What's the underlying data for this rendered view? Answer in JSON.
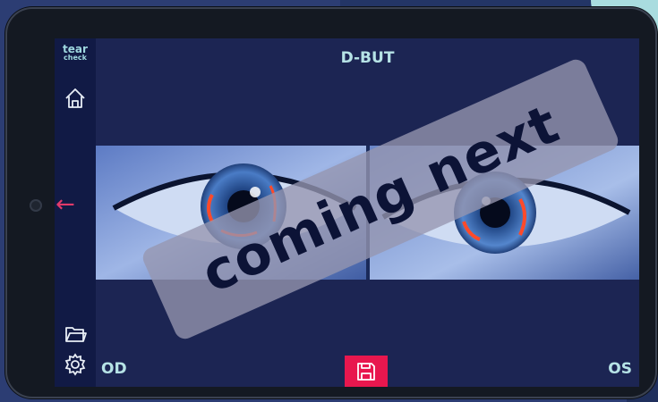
{
  "app": {
    "logo_line1": "tear",
    "logo_line2": "check",
    "title": "D-BUT"
  },
  "banner": {
    "text": "coming next"
  },
  "labels": {
    "left_eye": "OD",
    "right_eye": "OS"
  },
  "icons": {
    "home": "home-icon",
    "back": "arrow-left-icon",
    "folder": "folder-icon",
    "settings": "gear-icon",
    "save": "save-icon"
  },
  "colors": {
    "accent": "#e8174e",
    "title_text": "#b6e3e6",
    "sidebar": "#111a45",
    "screen": "#1c2553"
  }
}
